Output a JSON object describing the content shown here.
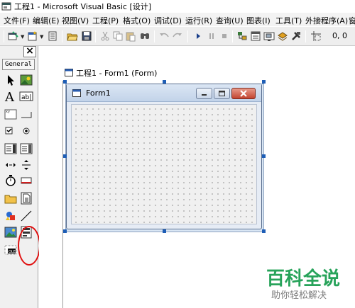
{
  "window": {
    "title": "工程1 - Microsoft Visual Basic [设计]"
  },
  "menu": [
    "文件(F)",
    "编辑(E)",
    "视图(V)",
    "工程(P)",
    "格式(O)",
    "调试(D)",
    "运行(R)",
    "查询(U)",
    "图表(I)",
    "工具(T)",
    "外接程序(A)",
    "窗"
  ],
  "toolbar": {
    "coordinates": "0, 0",
    "icons": [
      "add-project-icon",
      "add-form-icon",
      "menu-editor-icon",
      "open-project-icon",
      "save-project-icon",
      "cut-icon",
      "copy-icon",
      "paste-icon",
      "find-icon",
      "undo-icon",
      "redo-icon",
      "start-icon",
      "break-icon",
      "end-icon",
      "project-explorer-icon",
      "properties-window-icon",
      "form-layout-icon",
      "object-browser-icon",
      "toolbox-icon",
      "position-icon"
    ]
  },
  "toolbox": {
    "close_label": "×",
    "tab_label": "General",
    "tools": [
      "pointer",
      "picturebox",
      "label",
      "textbox",
      "frame",
      "commandbutton",
      "checkbox",
      "optionbutton",
      "combobox",
      "listbox",
      "hscrollbar",
      "vscrollbar",
      "timer",
      "drivelistbox",
      "dirlistbox",
      "filelistbox",
      "shape",
      "line",
      "image",
      "data",
      "ole"
    ]
  },
  "project_window": {
    "title": "工程1 - Form1 (Form)"
  },
  "form": {
    "title": "Form1"
  },
  "watermark": {
    "main": "百科全说",
    "sub": "助你轻松解决"
  },
  "colors": {
    "highlight_circle": "#e01010",
    "watermark_green": "#27a35a",
    "selection_handle": "#1e5eb6"
  }
}
